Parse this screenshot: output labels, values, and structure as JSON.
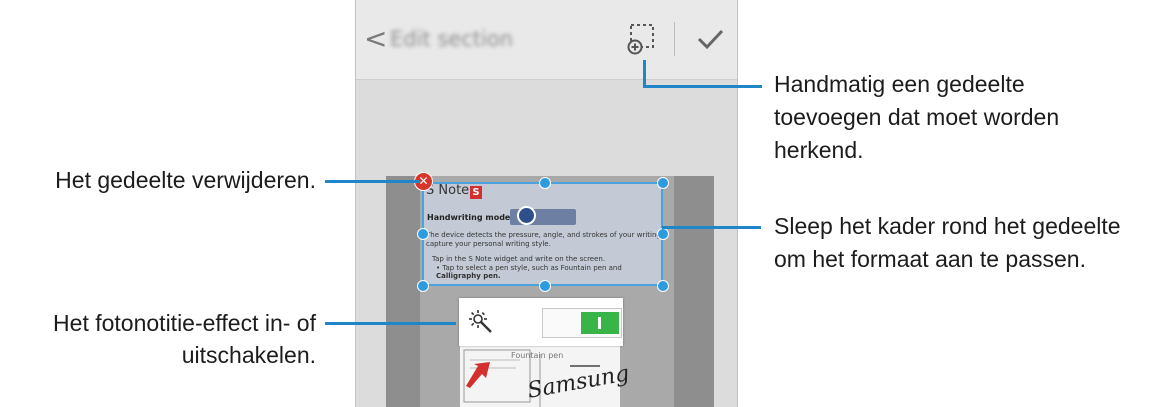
{
  "app_bar": {
    "back_label": "<",
    "title": "Edit section",
    "add_area_icon": "add-area-icon",
    "done_icon": "checkmark-icon"
  },
  "document": {
    "title": "S Note",
    "logo": "S",
    "mode_heading": "Handwriting mode",
    "line1": "The device detects the pressure, angle, and strokes of your writing to",
    "line2": "capture your personal writing style.",
    "line3": "Tap        in the S Note widget and write on the screen.",
    "line4": "• Tap        to select a pen style, such as Fountain pen and",
    "line5": "Calligraphy pen.",
    "pen_label": "Fountain pen",
    "signature": "Samsung"
  },
  "photo_note_toggle": {
    "state": "on",
    "icon": "sun-magic-icon"
  },
  "colors": {
    "accent": "#1f86c8",
    "handle": "#2e9be0",
    "delete": "#d9362b",
    "switch_on": "#38b449"
  },
  "callouts": {
    "add_area": [
      "Handmatig een gedeelte",
      "toevoegen dat moet worden",
      "herkend."
    ],
    "resize": [
      "Sleep het kader rond het gedeelte",
      "om het formaat aan te passen."
    ],
    "delete": [
      "Het gedeelte verwijderen."
    ],
    "toggle": [
      "Het fotonotitie-effect in- of",
      "uitschakelen."
    ]
  }
}
